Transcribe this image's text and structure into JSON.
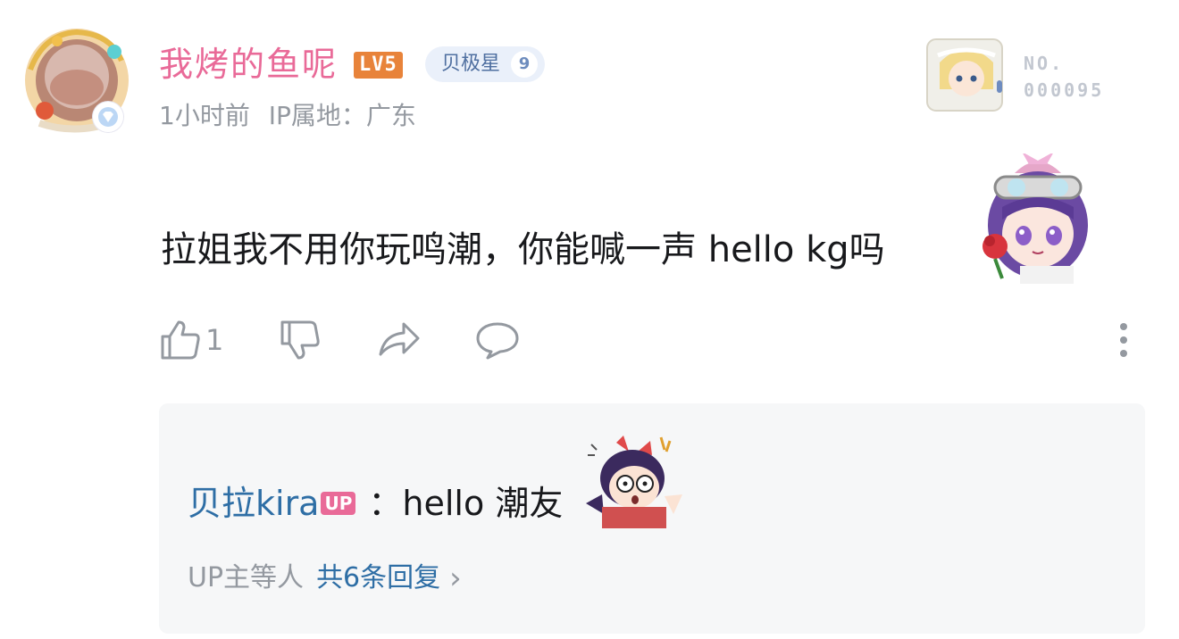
{
  "comment": {
    "username": "我烤的鱼呢",
    "level": "LV5",
    "fan_badge": {
      "name": "贝极星",
      "level": "9"
    },
    "time": "1小时前",
    "ip_location": "IP属地：广东",
    "garb_number_label": "NO.",
    "garb_number": "000095",
    "content": "拉姐我不用你玩鸣潮，你能喊一声 hello kg吗",
    "likes": "1",
    "icons": {
      "like": "thumbs-up-icon",
      "dislike": "thumbs-down-icon",
      "share": "share-icon",
      "reply": "reply-bubble-icon",
      "more": "more-vertical-icon"
    }
  },
  "reply_preview": {
    "author": "贝拉kira",
    "author_badge": "UP",
    "separator": "：",
    "text": "hello 潮友",
    "more_prefix": "UP主等人",
    "more_link": "共6条回复",
    "chevron": "›"
  },
  "colors": {
    "username_pink": "#e96a98",
    "link_blue": "#2e6ea5",
    "meta_gray": "#9499a0",
    "level_orange": "#e8833a",
    "reply_bg": "#f6f7f8"
  }
}
